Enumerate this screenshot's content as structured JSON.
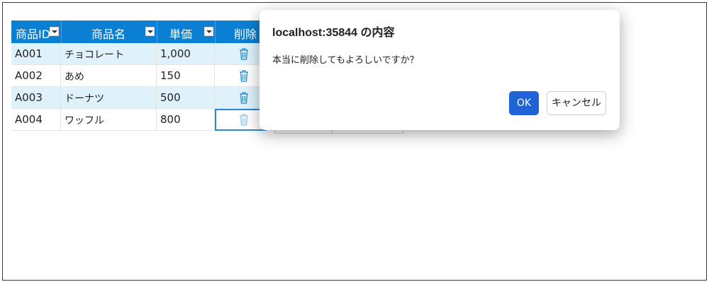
{
  "grid": {
    "headers": [
      "商品ID",
      "商品名",
      "単価",
      "削除"
    ],
    "rows": [
      {
        "id": "A001",
        "name": "チョコレート",
        "price": "1,000"
      },
      {
        "id": "A002",
        "name": "あめ",
        "price": "150"
      },
      {
        "id": "A003",
        "name": "ドーナツ",
        "price": "500"
      },
      {
        "id": "A004",
        "name": "ワッフル",
        "price": "800"
      }
    ],
    "icons": {
      "filter": "dropdown-icon",
      "delete": "trash-icon"
    }
  },
  "dialog": {
    "title": "localhost:35844 の内容",
    "message": "本当に削除してもよろしいですか？",
    "ok_label": "OK",
    "cancel_label": "キャンセル"
  },
  "colors": {
    "header": "#0b7fd1",
    "alt_row": "#dff1fb",
    "ok_button": "#1f63d6"
  }
}
